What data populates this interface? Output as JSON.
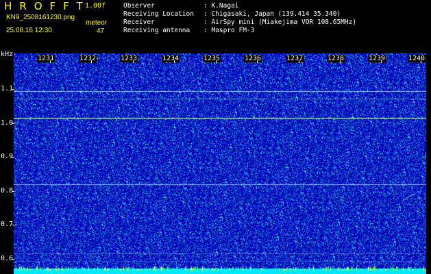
{
  "header": {
    "brand": "HROFFT",
    "version": "1.00f",
    "filename": "KN9_2508161230.png",
    "datetime": "25.08.16 12:30",
    "meteor_label": "meteor",
    "meteor_count": "47"
  },
  "info": [
    {
      "key": "Observer",
      "value": ": K.Nagai"
    },
    {
      "key": "Receiving Location",
      "value": ": Chigasaki, Japan (139.414 35.340)"
    },
    {
      "key": "Receiver",
      "value": ": AirSpy mini (Miakejima VOR 108.65MHz)"
    },
    {
      "key": "Receiving antenna",
      "value": ": Maspro FM-3"
    }
  ],
  "axis": {
    "y_unit": "kHz",
    "y_ticks": [
      "1.1",
      "1.0",
      "0.9",
      "0.8",
      "0.7",
      "0.6"
    ],
    "x_ticks": [
      "1231",
      "1232",
      "1233",
      "1234",
      "1235",
      "1236",
      "1237",
      "1238",
      "1239",
      "1240"
    ]
  },
  "colors": {
    "background": "#000000",
    "spectrum_bg": "#0000b4",
    "noise_bright": "#4fd0ff",
    "carrier_line": "#c8ffb4",
    "header_yellow": "#ffff00",
    "bottom_band": "#00e8ff"
  }
}
